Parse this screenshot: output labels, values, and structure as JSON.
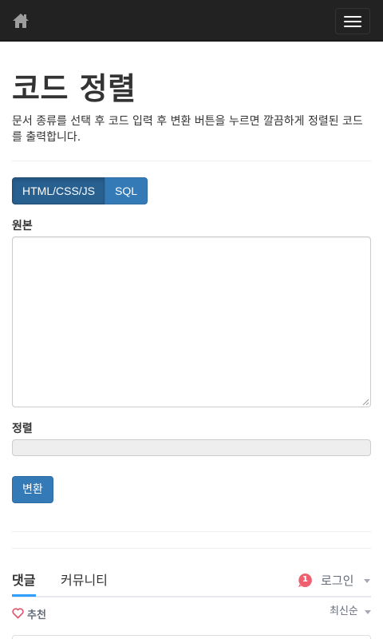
{
  "navbar": {
    "home_icon": "home-icon",
    "menu_icon": "hamburger-icon"
  },
  "header": {
    "title": "코드 정렬",
    "description": "문서 종류를 선택 후 코드 입력 후 변환 버튼을 누르면 깔끔하게 정렬된 코드를 출력합니다."
  },
  "doc_types": {
    "options": [
      "HTML/CSS/JS",
      "SQL"
    ],
    "selected": "HTML/CSS/JS"
  },
  "source": {
    "label": "원본",
    "value": ""
  },
  "output": {
    "label": "정렬",
    "value": ""
  },
  "convert_label": "변환",
  "comments": {
    "tabs": [
      "댓글",
      "커뮤니티"
    ],
    "active_tab": "댓글",
    "notification_count": "1",
    "login_label": "로그인",
    "recommend_label": "추천",
    "sort_label": "최신순",
    "accent_color": "#2e9fff",
    "badge_color": "#f05f70"
  }
}
